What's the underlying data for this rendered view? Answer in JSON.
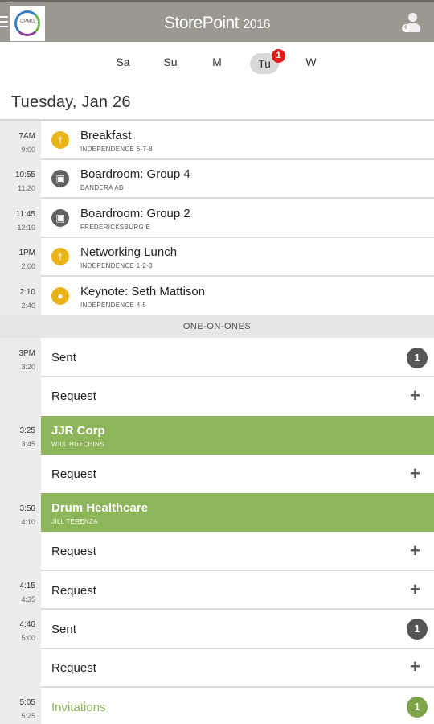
{
  "header": {
    "logo_text": "CPMG",
    "title": "StorePoint",
    "title_year": "2016"
  },
  "days": [
    "Sa",
    "Su",
    "M",
    "Tu",
    "W"
  ],
  "selected_day_badge": "1",
  "date_heading": "Tuesday, Jan 26",
  "events": [
    {
      "start": "7AM",
      "end": "9:00",
      "title": "Breakfast",
      "location": "INDEPENDENCE 6-7-8",
      "icon": "utensils-icon",
      "color": "#e8b417"
    },
    {
      "start": "10:55",
      "end": "11:20",
      "title": "Boardroom: Group 4",
      "location": "BANDERA AB",
      "icon": "presentation-icon",
      "color": "#616161"
    },
    {
      "start": "11:45",
      "end": "12:10",
      "title": "Boardroom: Group 2",
      "location": "FREDERICKSBURG E",
      "icon": "presentation-icon",
      "color": "#616161"
    },
    {
      "start": "1PM",
      "end": "2:00",
      "title": "Networking Lunch",
      "location": "INDEPENDENCE 1-2-3",
      "icon": "utensils-icon",
      "color": "#e8b417"
    },
    {
      "start": "2:10",
      "end": "2:40",
      "title": "Keynote: Seth Mattison",
      "location": "INDEPENDENCE 4-5",
      "icon": "microphone-icon",
      "color": "#e8b417"
    }
  ],
  "section_label": "ONE-ON-ONES",
  "slots": [
    {
      "start": "3PM",
      "end": "3:20",
      "label": "Sent",
      "count": "1"
    },
    {
      "label": "Request"
    },
    {
      "start": "3:25",
      "end": "3:45",
      "company": "JJR Corp",
      "contact": "WILL HUTCHINS"
    },
    {
      "label": "Request"
    },
    {
      "start": "3:50",
      "end": "4:10",
      "company": "Drum Healthcare",
      "contact": "JILL TERENZA"
    },
    {
      "label": "Request"
    },
    {
      "start": "4:15",
      "end": "4:35",
      "label": "Request"
    },
    {
      "start": "4:40",
      "end": "5:00",
      "label": "Sent",
      "count": "1"
    },
    {
      "label": "Request"
    },
    {
      "start": "5:05",
      "end": "5:25",
      "label": "Invitations",
      "count": "1"
    }
  ],
  "plus_symbol": "+"
}
